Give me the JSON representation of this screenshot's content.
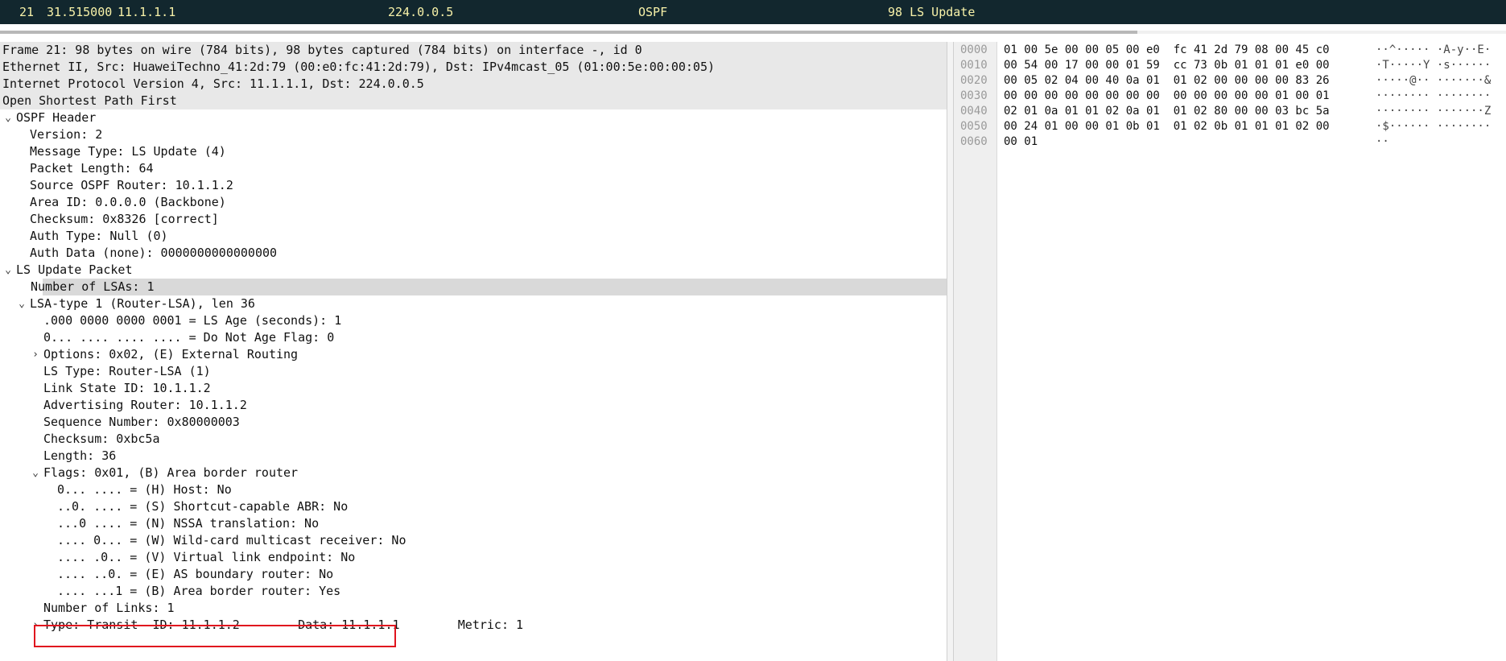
{
  "packet_list": {
    "selected_row": {
      "no": "21",
      "time": "31.515000",
      "source": "11.1.1.1",
      "destination": "224.0.0.5",
      "protocol": "OSPF",
      "info": "98 LS Update"
    }
  },
  "colors": {
    "packet_row_bg": "#12272e",
    "packet_row_fg": "#f7f1a8",
    "selection_bg": "#d9d9d9",
    "highlight_box": "#e0141e"
  },
  "detail_tree": [
    {
      "text": "Frame 21: 98 bytes on wire (784 bits), 98 bytes captured (784 bits) on interface -, id 0",
      "level": 0,
      "expander": "",
      "style": "hl"
    },
    {
      "text": "Ethernet II, Src: HuaweiTechno_41:2d:79 (00:e0:fc:41:2d:79), Dst: IPv4mcast_05 (01:00:5e:00:00:05)",
      "level": 0,
      "expander": "",
      "style": "hl"
    },
    {
      "text": "Internet Protocol Version 4, Src: 11.1.1.1, Dst: 224.0.0.5",
      "level": 0,
      "expander": "",
      "style": "hl"
    },
    {
      "text": "Open Shortest Path First",
      "level": 0,
      "expander": "",
      "style": "hl"
    },
    {
      "text": "OSPF Header",
      "level": 1,
      "expander": "⌄",
      "style": ""
    },
    {
      "text": "Version: 2",
      "level": 2,
      "expander": "",
      "style": ""
    },
    {
      "text": "Message Type: LS Update (4)",
      "level": 2,
      "expander": "",
      "style": ""
    },
    {
      "text": "Packet Length: 64",
      "level": 2,
      "expander": "",
      "style": ""
    },
    {
      "text": "Source OSPF Router: 10.1.1.2",
      "level": 2,
      "expander": "",
      "style": ""
    },
    {
      "text": "Area ID: 0.0.0.0 (Backbone)",
      "level": 2,
      "expander": "",
      "style": ""
    },
    {
      "text": "Checksum: 0x8326 [correct]",
      "level": 2,
      "expander": "",
      "style": ""
    },
    {
      "text": "Auth Type: Null (0)",
      "level": 2,
      "expander": "",
      "style": ""
    },
    {
      "text": "Auth Data (none): 0000000000000000",
      "level": 2,
      "expander": "",
      "style": ""
    },
    {
      "text": "LS Update Packet",
      "level": 1,
      "expander": "⌄",
      "style": ""
    },
    {
      "text": "Number of LSAs: 1",
      "level": 2,
      "expander": "",
      "style": "sel"
    },
    {
      "text": "LSA-type 1 (Router-LSA), len 36",
      "level": 2,
      "expander": "⌄",
      "style": ""
    },
    {
      "text": ".000 0000 0000 0001 = LS Age (seconds): 1",
      "level": 3,
      "expander": "",
      "style": ""
    },
    {
      "text": "0... .... .... .... = Do Not Age Flag: 0",
      "level": 3,
      "expander": "",
      "style": ""
    },
    {
      "text": "Options: 0x02, (E) External Routing",
      "level": 3,
      "expander": "›",
      "style": ""
    },
    {
      "text": "LS Type: Router-LSA (1)",
      "level": 3,
      "expander": "",
      "style": ""
    },
    {
      "text": "Link State ID: 10.1.1.2",
      "level": 3,
      "expander": "",
      "style": ""
    },
    {
      "text": "Advertising Router: 10.1.1.2",
      "level": 3,
      "expander": "",
      "style": ""
    },
    {
      "text": "Sequence Number: 0x80000003",
      "level": 3,
      "expander": "",
      "style": ""
    },
    {
      "text": "Checksum: 0xbc5a",
      "level": 3,
      "expander": "",
      "style": ""
    },
    {
      "text": "Length: 36",
      "level": 3,
      "expander": "",
      "style": ""
    },
    {
      "text": "Flags: 0x01, (B) Area border router",
      "level": 3,
      "expander": "⌄",
      "style": ""
    },
    {
      "text": "0... .... = (H) Host: No",
      "level": 4,
      "expander": "",
      "style": ""
    },
    {
      "text": "..0. .... = (S) Shortcut-capable ABR: No",
      "level": 4,
      "expander": "",
      "style": ""
    },
    {
      "text": "...0 .... = (N) NSSA translation: No",
      "level": 4,
      "expander": "",
      "style": ""
    },
    {
      "text": ".... 0... = (W) Wild-card multicast receiver: No",
      "level": 4,
      "expander": "",
      "style": ""
    },
    {
      "text": ".... .0.. = (V) Virtual link endpoint: No",
      "level": 4,
      "expander": "",
      "style": ""
    },
    {
      "text": ".... ..0. = (E) AS boundary router: No",
      "level": 4,
      "expander": "",
      "style": ""
    },
    {
      "text": ".... ...1 = (B) Area border router: Yes",
      "level": 4,
      "expander": "",
      "style": ""
    },
    {
      "text": "Number of Links: 1",
      "level": 3,
      "expander": "",
      "style": ""
    },
    {
      "text": "Type: Transit  ID: 11.1.1.2        Data: 11.1.1.1        Metric: 1",
      "level": 3,
      "expander": "›",
      "style": ""
    }
  ],
  "hex_dump": [
    {
      "offset": "0000",
      "bytes": "01 00 5e 00 00 05 00 e0  fc 41 2d 79 08 00 45 c0",
      "ascii": "··^····· ·A-y··E·"
    },
    {
      "offset": "0010",
      "bytes": "00 54 00 17 00 00 01 59  cc 73 0b 01 01 01 e0 00",
      "ascii": "·T·····Y ·s······"
    },
    {
      "offset": "0020",
      "bytes": "00 05 02 04 00 40 0a 01  01 02 00 00 00 00 83 26",
      "ascii": "·····@·· ·······&"
    },
    {
      "offset": "0030",
      "bytes": "00 00 00 00 00 00 00 00  00 00 00 00 00 01 00 01",
      "ascii": "········ ········"
    },
    {
      "offset": "0040",
      "bytes": "02 01 0a 01 01 02 0a 01  01 02 80 00 00 03 bc 5a",
      "ascii": "········ ·······Z"
    },
    {
      "offset": "0050",
      "bytes": "00 24 01 00 00 01 0b 01  01 02 0b 01 01 01 02 00",
      "ascii": "·$······ ········"
    },
    {
      "offset": "0060",
      "bytes": "00 01",
      "ascii": "··"
    }
  ]
}
